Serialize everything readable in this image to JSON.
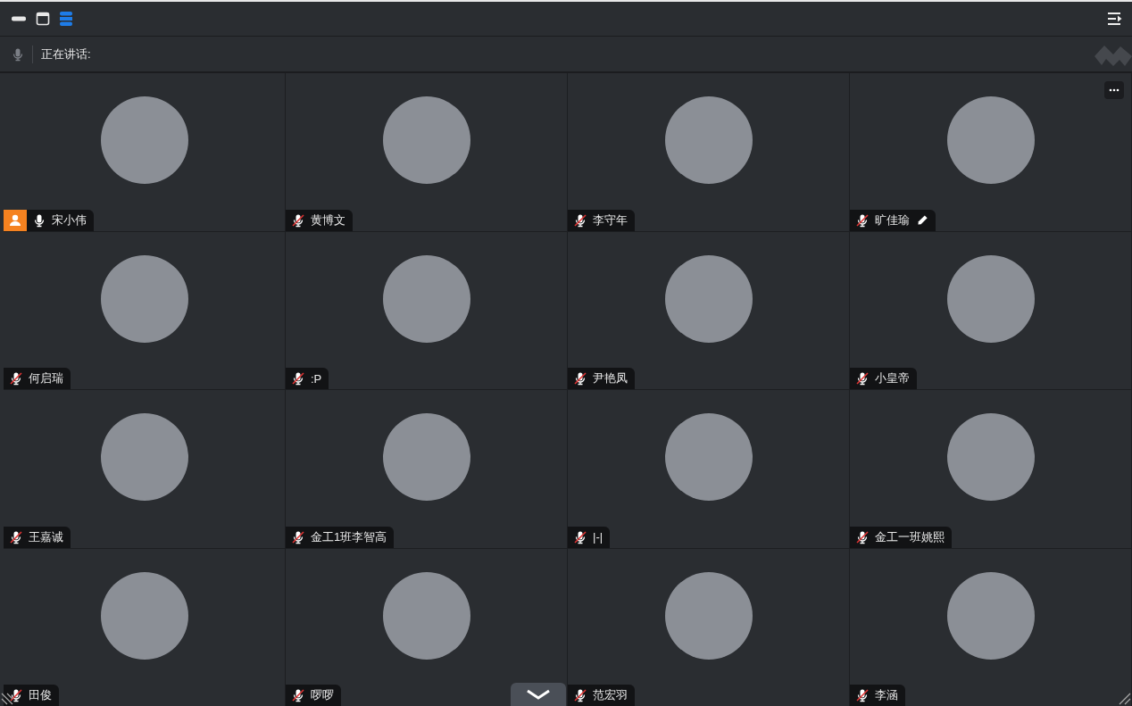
{
  "toolbar": {
    "layout_selected": true
  },
  "speaking_bar": {
    "label": "正在讲话:"
  },
  "participants": [
    {
      "name": "宋小伟",
      "muted": false,
      "host": true,
      "annotating": false,
      "menu": false
    },
    {
      "name": "黄博文",
      "muted": true,
      "host": false,
      "annotating": false,
      "menu": false
    },
    {
      "name": "李守年",
      "muted": true,
      "host": false,
      "annotating": false,
      "menu": false
    },
    {
      "name": "旷佳瑜",
      "muted": true,
      "host": false,
      "annotating": true,
      "menu": true
    },
    {
      "name": "何启瑞",
      "muted": true,
      "host": false,
      "annotating": false,
      "menu": false
    },
    {
      "name": ":P",
      "muted": true,
      "host": false,
      "annotating": false,
      "menu": false
    },
    {
      "name": "尹艳凤",
      "muted": true,
      "host": false,
      "annotating": false,
      "menu": false
    },
    {
      "name": "小皇帝",
      "muted": true,
      "host": false,
      "annotating": false,
      "menu": false
    },
    {
      "name": "王嘉诚",
      "muted": true,
      "host": false,
      "annotating": false,
      "menu": false
    },
    {
      "name": "金工1班李智高",
      "muted": true,
      "host": false,
      "annotating": false,
      "menu": false
    },
    {
      "name": "|-|",
      "muted": true,
      "host": false,
      "annotating": false,
      "menu": false
    },
    {
      "name": "金工一班姚熙",
      "muted": true,
      "host": false,
      "annotating": false,
      "menu": false
    },
    {
      "name": "田俊",
      "muted": true,
      "host": false,
      "annotating": false,
      "menu": false
    },
    {
      "name": "啰啰",
      "muted": true,
      "host": false,
      "annotating": false,
      "menu": false
    },
    {
      "name": "范宏羽",
      "muted": true,
      "host": false,
      "annotating": false,
      "menu": false
    },
    {
      "name": "李涵",
      "muted": true,
      "host": false,
      "annotating": false,
      "menu": false
    }
  ]
}
